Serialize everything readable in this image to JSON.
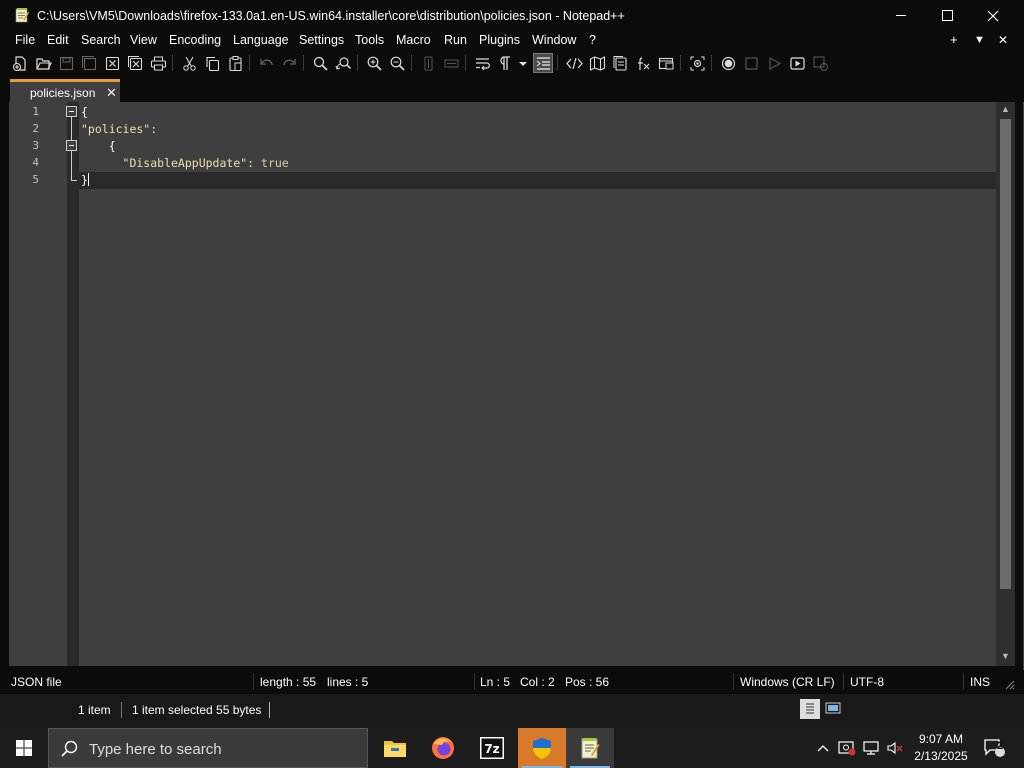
{
  "window": {
    "title": "C:\\Users\\VM5\\Downloads\\firefox-133.0a1.en-US.win64.installer\\core\\distribution\\policies.json - Notepad++",
    "minimize_glyph": "—",
    "maximize_glyph": "☐",
    "close_glyph": "✕"
  },
  "menu": {
    "items": [
      "File",
      "Edit",
      "Search",
      "View",
      "Encoding",
      "Language",
      "Settings",
      "Tools",
      "Macro",
      "Run",
      "Plugins",
      "Window",
      "?"
    ],
    "right": [
      "+",
      "▼",
      "✕"
    ]
  },
  "toolbar": {
    "icons": [
      "new-file",
      "open-file",
      "save",
      "save-all",
      "close",
      "close-all",
      "print",
      "cut",
      "copy",
      "paste",
      "undo",
      "redo",
      "find",
      "replace",
      "zoom-in",
      "zoom-out",
      "sync-vertical",
      "sync-horizontal",
      "word-wrap",
      "show-all-characters",
      "indent-guide",
      "user-defined-language",
      "xml-tag",
      "document-map",
      "document-list",
      "function-list",
      "folder-as-workspace",
      "monitoring",
      "record-macro",
      "stop-recording",
      "playback",
      "run-macro-multiple",
      "save-macro"
    ]
  },
  "tab": {
    "label": "policies.json",
    "close_glyph": "✕"
  },
  "editor": {
    "line_numbers": [
      "1",
      "2",
      "3",
      "4",
      "5"
    ],
    "lines": [
      [
        {
          "t": "{",
          "c": "brace"
        }
      ],
      [
        {
          "t": "\"policies\"",
          "c": "key"
        },
        {
          "t": ":",
          "c": "punct"
        }
      ],
      [
        {
          "t": "    {",
          "c": "brace"
        }
      ],
      [
        {
          "t": "      \"DisableAppUpdate\"",
          "c": "key"
        },
        {
          "t": ": ",
          "c": "punct"
        },
        {
          "t": "true",
          "c": "value"
        }
      ],
      [
        {
          "t": "}",
          "c": "brace"
        }
      ]
    ],
    "colors": {
      "brace": "#ffffff",
      "key": "#f0dfaf",
      "punct": "#dcdccc",
      "value": "#e0cf9f"
    }
  },
  "status": {
    "file_type": "JSON file",
    "length": "length : 55",
    "lines": "lines : 5",
    "ln": "Ln : 5",
    "col": "Col : 2",
    "pos": "Pos : 56",
    "eol": "Windows (CR LF)",
    "encoding": "UTF-8",
    "mode": "INS"
  },
  "explorer": {
    "item_count": "1 item",
    "selection": "1 item selected  55 bytes"
  },
  "taskbar": {
    "search_placeholder": "Type here to search",
    "apps": [
      "file-explorer",
      "firefox",
      "7zip",
      "shield-setup",
      "notepad-plus-plus"
    ],
    "time": "9:07 AM",
    "date": "2/13/2025",
    "notification_count": "2"
  }
}
